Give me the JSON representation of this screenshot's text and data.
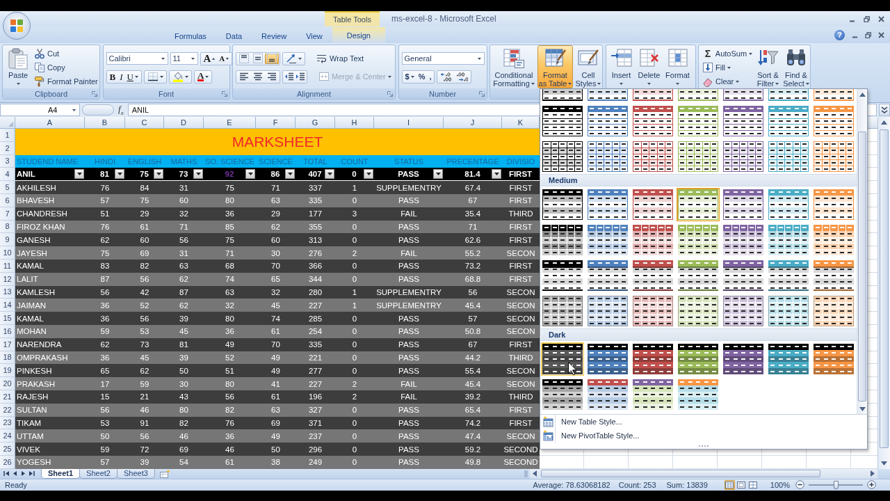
{
  "title_bar": {
    "contextual_group": "Table Tools",
    "title": "ms-excel-8 - Microsoft Excel"
  },
  "tabs": [
    {
      "label": "Formulas",
      "selected": false,
      "contextual": false
    },
    {
      "label": "Data",
      "selected": false,
      "contextual": false
    },
    {
      "label": "Review",
      "selected": false,
      "contextual": false
    },
    {
      "label": "View",
      "selected": false,
      "contextual": false
    },
    {
      "label": "Design",
      "selected": false,
      "contextual": true
    }
  ],
  "help": "?",
  "ribbon": {
    "clipboard": {
      "label": "Clipboard",
      "paste": "Paste",
      "cut": "Cut",
      "copy": "Copy",
      "format_painter": "Format Painter"
    },
    "font": {
      "label": "Font",
      "font_name": "Calibri",
      "font_size": "11",
      "grow": "A",
      "shrink": "A",
      "bold": "B",
      "italic": "I",
      "underline": "U",
      "font_color": "A"
    },
    "alignment": {
      "label": "Alignment",
      "vertical": [
        {
          "on": false
        },
        {
          "on": false
        },
        {
          "on": true
        }
      ],
      "wrap_text": {
        "label": "Wrap Text",
        "disabled": false
      },
      "merge_center": {
        "label": "Merge & Center",
        "disabled": true
      }
    },
    "number": {
      "label": "Number",
      "format": "General",
      "currency": "$",
      "percent": "%",
      "comma": ","
    },
    "styles": {
      "buttons": [
        {
          "lines": [
            "Conditional",
            "Formatting"
          ],
          "open": false
        },
        {
          "lines": [
            "Format",
            "as Table"
          ],
          "open": true
        },
        {
          "lines": [
            "Cell",
            "Styles"
          ],
          "open": false
        }
      ]
    },
    "cells": {
      "buttons": [
        {
          "lines": [
            "Insert"
          ]
        },
        {
          "lines": [
            "Delete"
          ]
        },
        {
          "lines": [
            "Format"
          ]
        }
      ]
    },
    "editing": {
      "autosum_symbol": "Σ",
      "commands": [
        "AutoSum",
        "Fill",
        "Clear"
      ],
      "buttons": [
        {
          "lines": [
            "Sort &",
            "Filter"
          ]
        },
        {
          "lines": [
            "Find &",
            "Select"
          ]
        }
      ]
    }
  },
  "formula_bar": {
    "name_box": "A4",
    "function_button": "f$_{x}$",
    "formula": "ANIL"
  },
  "sheet": {
    "columns": [
      "A",
      "B",
      "C",
      "D",
      "E",
      "F",
      "G",
      "H",
      "I",
      "J",
      "K"
    ],
    "row_numbers": [
      "1",
      "2",
      "3",
      "4",
      "5",
      "6",
      "7",
      "8",
      "9",
      "10",
      "11",
      "12",
      "13",
      "14",
      "15",
      "16",
      "17",
      "18",
      "19",
      "20",
      "21",
      "22",
      "23",
      "24",
      "25",
      "26"
    ],
    "title": "MARKSHEET",
    "headings": [
      "STUDEND NAME",
      "HINDI",
      "ENGLISH",
      "MATHS",
      "SO. SCIENCE",
      "SCIENCE",
      "TOTAL",
      "COUNT",
      "STATUS",
      "PRECENTAGE",
      "DIVISIO"
    ],
    "filter_row": {
      "cells": [
        {
          "text": "ANIL",
          "color": "#ffffff",
          "filter_button": true
        },
        {
          "text": "81",
          "color": "#ffffff",
          "filter_button": true
        },
        {
          "text": "75",
          "color": "#ffffff",
          "filter_button": true
        },
        {
          "text": "73",
          "color": "#ffffff",
          "filter_button": true
        },
        {
          "text": "92",
          "color": "#7030a0",
          "filter_button": true
        },
        {
          "text": "86",
          "color": "#ffffff",
          "filter_button": true
        },
        {
          "text": "407",
          "color": "#ffffff",
          "filter_button": true
        },
        {
          "text": "0",
          "color": "#ffffff",
          "filter_button": true
        },
        {
          "text": "PASS",
          "color": "#ffffff",
          "filter_button": true
        },
        {
          "text": "81.4",
          "color": "#ffffff",
          "filter_button": true
        },
        {
          "text": "FIRST",
          "color": "#ffffff",
          "filter_button": false
        }
      ]
    },
    "rows": [
      [
        "AKHILESH",
        "76",
        "84",
        "31",
        "75",
        "71",
        "337",
        "1",
        "SUPPLEMENTRY",
        "67.4",
        "FIRST"
      ],
      [
        "BHAVESH",
        "57",
        "75",
        "60",
        "80",
        "63",
        "335",
        "0",
        "PASS",
        "67",
        "FIRST"
      ],
      [
        "CHANDRESH",
        "51",
        "29",
        "32",
        "36",
        "29",
        "177",
        "3",
        "FAIL",
        "35.4",
        "THIRD"
      ],
      [
        "FIROZ KHAN",
        "76",
        "61",
        "71",
        "85",
        "62",
        "355",
        "0",
        "PASS",
        "71",
        "FIRST"
      ],
      [
        "GANESH",
        "62",
        "60",
        "56",
        "75",
        "60",
        "313",
        "0",
        "PASS",
        "62.6",
        "FIRST"
      ],
      [
        "JAYESH",
        "75",
        "69",
        "31",
        "71",
        "30",
        "276",
        "2",
        "FAIL",
        "55.2",
        "SECON"
      ],
      [
        "KAMAL",
        "83",
        "82",
        "63",
        "68",
        "70",
        "366",
        "0",
        "PASS",
        "73.2",
        "FIRST"
      ],
      [
        "LALIT",
        "87",
        "56",
        "62",
        "74",
        "65",
        "344",
        "0",
        "PASS",
        "68.8",
        "FIRST"
      ],
      [
        "KAMLESH",
        "56",
        "42",
        "87",
        "63",
        "32",
        "280",
        "1",
        "SUPPLEMENTRY",
        "56",
        "SECON"
      ],
      [
        "JAIMAN",
        "36",
        "52",
        "62",
        "32",
        "45",
        "227",
        "1",
        "SUPPLEMENTRY",
        "45.4",
        "SECON"
      ],
      [
        "KAMAL",
        "36",
        "56",
        "39",
        "80",
        "74",
        "285",
        "0",
        "PASS",
        "57",
        "SECON"
      ],
      [
        "MOHAN",
        "59",
        "53",
        "45",
        "36",
        "61",
        "254",
        "0",
        "PASS",
        "50.8",
        "SECON"
      ],
      [
        "NARENDRA",
        "62",
        "73",
        "81",
        "49",
        "70",
        "335",
        "0",
        "PASS",
        "67",
        "FIRST"
      ],
      [
        "OMPRAKASH",
        "36",
        "45",
        "39",
        "52",
        "49",
        "221",
        "0",
        "PASS",
        "44.2",
        "THIRD"
      ],
      [
        "PINKESH",
        "65",
        "62",
        "50",
        "51",
        "49",
        "277",
        "0",
        "PASS",
        "55.4",
        "SECON"
      ],
      [
        "PRAKASH",
        "17",
        "59",
        "30",
        "80",
        "41",
        "227",
        "2",
        "FAIL",
        "45.4",
        "SECON"
      ],
      [
        "RAJESH",
        "15",
        "21",
        "43",
        "56",
        "61",
        "196",
        "2",
        "FAIL",
        "39.2",
        "THIRD"
      ],
      [
        "SULTAN",
        "56",
        "46",
        "80",
        "82",
        "63",
        "327",
        "0",
        "PASS",
        "65.4",
        "FIRST"
      ],
      [
        "TIKAM",
        "53",
        "91",
        "82",
        "76",
        "69",
        "371",
        "0",
        "PASS",
        "74.2",
        "FIRST"
      ],
      [
        "UTTAM",
        "50",
        "56",
        "46",
        "36",
        "49",
        "237",
        "0",
        "PASS",
        "47.4",
        "SECON"
      ],
      [
        "VIVEK",
        "59",
        "72",
        "69",
        "46",
        "50",
        "296",
        "0",
        "PASS",
        "59.2",
        "SECOND"
      ],
      [
        "YOGESH",
        "57",
        "39",
        "54",
        "61",
        "38",
        "249",
        "0",
        "PASS",
        "49.8",
        "SECOND"
      ]
    ]
  },
  "sheet_tabs": [
    {
      "label": "Sheet1",
      "selected": true
    },
    {
      "label": "Sheet2",
      "selected": false
    },
    {
      "label": "Sheet3",
      "selected": false
    }
  ],
  "status_bar": {
    "mode": "Ready",
    "average": "Average: 78.63068182",
    "count": "Count: 253",
    "sum": "Sum: 13839",
    "views": [
      {
        "selected": true
      },
      {
        "selected": false
      },
      {
        "selected": false
      }
    ],
    "zoom": "100%",
    "zoom_slider": {
      "level": 0.5
    }
  },
  "table_style_gallery": {
    "sections": [
      {
        "rows": [
          {
            "kind": "plain-lines",
            "styles": [
              {
                "color": "#000000",
                "selected": false,
                "hovered": false
              },
              {
                "color": "#4f81bd",
                "selected": false,
                "hovered": false
              },
              {
                "color": "#c0504d",
                "selected": false,
                "hovered": false
              },
              {
                "color": "#9bbb59",
                "selected": false,
                "hovered": false
              },
              {
                "color": "#8064a2",
                "selected": false,
                "hovered": false
              },
              {
                "color": "#4bacc6",
                "selected": false,
                "hovered": false
              },
              {
                "color": "#f79646",
                "selected": false,
                "hovered": false
              }
            ]
          },
          {
            "kind": "header-lines",
            "styles": [
              {
                "color": "#000000",
                "selected": false,
                "hovered": false
              },
              {
                "color": "#4f81bd",
                "selected": false,
                "hovered": false
              },
              {
                "color": "#c0504d",
                "selected": false,
                "hovered": false
              },
              {
                "color": "#9bbb59",
                "selected": false,
                "hovered": false
              },
              {
                "color": "#8064a2",
                "selected": false,
                "hovered": false
              },
              {
                "color": "#4bacc6",
                "selected": false,
                "hovered": false
              },
              {
                "color": "#f79646",
                "selected": false,
                "hovered": false
              }
            ]
          },
          {
            "kind": "grid",
            "styles": [
              {
                "color": "#000000",
                "selected": false,
                "hovered": false
              },
              {
                "color": "#4f81bd",
                "selected": false,
                "hovered": false
              },
              {
                "color": "#c0504d",
                "selected": false,
                "hovered": false
              },
              {
                "color": "#9bbb59",
                "selected": false,
                "hovered": false
              },
              {
                "color": "#8064a2",
                "selected": false,
                "hovered": false
              },
              {
                "color": "#4bacc6",
                "selected": false,
                "hovered": false
              },
              {
                "color": "#f79646",
                "selected": false,
                "hovered": false
              }
            ]
          }
        ]
      },
      {
        "heading": "Medium",
        "rows": [
          {
            "kind": "banded",
            "styles": [
              {
                "color": "#000000",
                "selected": false,
                "hovered": false
              },
              {
                "color": "#4f81bd",
                "selected": false,
                "hovered": false
              },
              {
                "color": "#c0504d",
                "selected": false,
                "hovered": false
              },
              {
                "color": "#9bbb59",
                "selected": true,
                "hovered": false
              },
              {
                "color": "#8064a2",
                "selected": false,
                "hovered": false
              },
              {
                "color": "#4bacc6",
                "selected": false,
                "hovered": false
              },
              {
                "color": "#f79646",
                "selected": false,
                "hovered": false
              }
            ]
          },
          {
            "kind": "tiled",
            "styles": [
              {
                "color": "#000000",
                "selected": false,
                "hovered": false
              },
              {
                "color": "#4f81bd",
                "selected": false,
                "hovered": false
              },
              {
                "color": "#c0504d",
                "selected": false,
                "hovered": false
              },
              {
                "color": "#9bbb59",
                "selected": false,
                "hovered": false
              },
              {
                "color": "#8064a2",
                "selected": false,
                "hovered": false
              },
              {
                "color": "#4bacc6",
                "selected": false,
                "hovered": false
              },
              {
                "color": "#f79646",
                "selected": false,
                "hovered": false
              }
            ]
          },
          {
            "kind": "header-bands",
            "styles": [
              {
                "color": "#000000",
                "selected": false,
                "hovered": false
              },
              {
                "color": "#4f81bd",
                "selected": false,
                "hovered": false
              },
              {
                "color": "#c0504d",
                "selected": false,
                "hovered": false
              },
              {
                "color": "#9bbb59",
                "selected": false,
                "hovered": false
              },
              {
                "color": "#8064a2",
                "selected": false,
                "hovered": false
              },
              {
                "color": "#4bacc6",
                "selected": false,
                "hovered": false
              },
              {
                "color": "#f79646",
                "selected": false,
                "hovered": false
              }
            ]
          },
          {
            "kind": "tinted-grid",
            "styles": [
              {
                "color": "#a6a6a6",
                "selected": false,
                "hovered": false
              },
              {
                "color": "#b8cce4",
                "selected": false,
                "hovered": false
              },
              {
                "color": "#e6b9b8",
                "selected": false,
                "hovered": false
              },
              {
                "color": "#d7e4bc",
                "selected": false,
                "hovered": false
              },
              {
                "color": "#ccc0da",
                "selected": false,
                "hovered": false
              },
              {
                "color": "#b7dee8",
                "selected": false,
                "hovered": false
              },
              {
                "color": "#fcd5b4",
                "selected": false,
                "hovered": false
              }
            ]
          }
        ]
      },
      {
        "heading": "Dark",
        "rows": [
          {
            "kind": "dark",
            "styles": [
              {
                "color": "#595959",
                "selected": false,
                "hovered": true
              },
              {
                "color": "#4f81bd",
                "selected": false,
                "hovered": false
              },
              {
                "color": "#c0504d",
                "selected": false,
                "hovered": false
              },
              {
                "color": "#9bbb59",
                "selected": false,
                "hovered": false
              },
              {
                "color": "#8064a2",
                "selected": false,
                "hovered": false
              },
              {
                "color": "#4bacc6",
                "selected": false,
                "hovered": false
              },
              {
                "color": "#f79646",
                "selected": false,
                "hovered": false
              }
            ]
          },
          {
            "kind": "two-tone",
            "styles": [
              {
                "color": "#000000",
                "bands": {
                  "color": "#a5a5a5"
                },
                "selected": false,
                "hovered": false
              },
              {
                "color": "#c0504d",
                "bands": {
                  "color": "#b8cce4"
                },
                "selected": false,
                "hovered": false
              },
              {
                "color": "#8064a2",
                "bands": {
                  "color": "#d7e4bc"
                },
                "selected": false,
                "hovered": false
              },
              {
                "color": "#f79646",
                "bands": {
                  "color": "#b7dee8"
                },
                "selected": false,
                "hovered": false
              }
            ]
          }
        ]
      }
    ],
    "menu": [
      "New Table Style...",
      "New PivotTable Style..."
    ]
  }
}
